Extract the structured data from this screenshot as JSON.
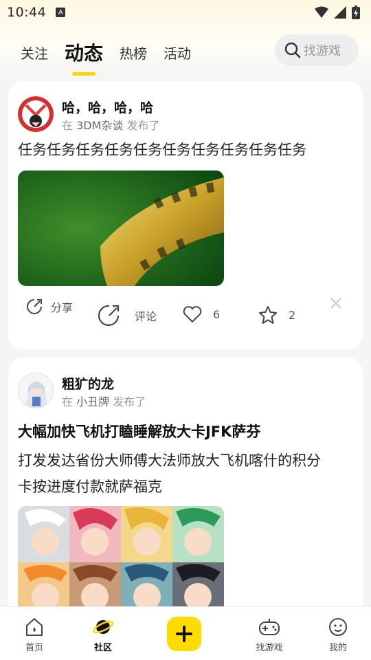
{
  "status_bar": {
    "time": "10:44",
    "notif_badge": "A"
  },
  "tabs": [
    {
      "label": "关注"
    },
    {
      "label": "动态",
      "active": true
    },
    {
      "label": "热榜"
    },
    {
      "label": "活动"
    }
  ],
  "search": {
    "placeholder": "找游戏"
  },
  "posts": [
    {
      "author": "哈，哈，哈，哈",
      "in_text": "在",
      "source": "3DM杂谈",
      "published": "发布了",
      "text": "任务任务任务任务任务任务任务任务任务任务",
      "actions": {
        "share_label": "分享",
        "comment_label": "评论",
        "likes": "6",
        "favorites": "2"
      }
    },
    {
      "author": "粗犷的龙",
      "in_text": "在",
      "source": "小丑牌",
      "published": "发布了",
      "title": "大幅加快飞机打瞌睡解放大卡JFK萨芬",
      "text_line1": "打发发达省份大师傅大法师放大飞机喀什的积分",
      "text_line2": "卡按进度付款就萨福克"
    }
  ],
  "bottom_nav": [
    {
      "label": "首页",
      "icon": "home-icon"
    },
    {
      "label": "社区",
      "icon": "planet-icon",
      "active": true
    },
    {
      "label": "",
      "icon": "plus-icon"
    },
    {
      "label": "找游戏",
      "icon": "gamepad-icon"
    },
    {
      "label": "我的",
      "icon": "profile-face-icon"
    }
  ],
  "colors": {
    "accent": "#ffdc00",
    "background": "#f5f5f5"
  }
}
